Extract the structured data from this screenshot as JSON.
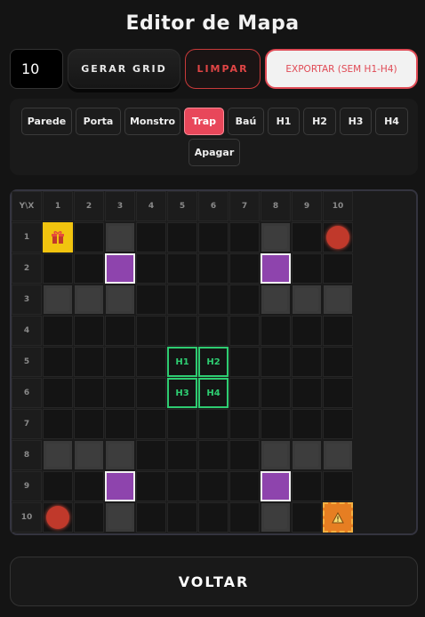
{
  "title": "Editor de Mapa",
  "grid_size_value": "10",
  "buttons": {
    "generate": "GERAR GRID",
    "clear": "LIMPAR",
    "export": "EXPORTAR (SEM H1-H4)",
    "back": "VOLTAR"
  },
  "tools": [
    "Parede",
    "Porta",
    "Monstro",
    "Trap",
    "Baú",
    "H1",
    "H2",
    "H3",
    "H4",
    "Apagar"
  ],
  "active_tool": "Trap",
  "grid": {
    "corner": "Y\\X",
    "cols": [
      "1",
      "2",
      "3",
      "4",
      "5",
      "6",
      "7",
      "8",
      "9",
      "10"
    ],
    "rows": [
      "1",
      "2",
      "3",
      "4",
      "5",
      "6",
      "7",
      "8",
      "9",
      "10"
    ],
    "cells": [
      {
        "x": 1,
        "y": 1,
        "type": "chest"
      },
      {
        "x": 3,
        "y": 1,
        "type": "wall"
      },
      {
        "x": 8,
        "y": 1,
        "type": "wall"
      },
      {
        "x": 10,
        "y": 1,
        "type": "monster"
      },
      {
        "x": 3,
        "y": 2,
        "type": "door"
      },
      {
        "x": 8,
        "y": 2,
        "type": "door"
      },
      {
        "x": 1,
        "y": 3,
        "type": "wall"
      },
      {
        "x": 2,
        "y": 3,
        "type": "wall"
      },
      {
        "x": 3,
        "y": 3,
        "type": "wall"
      },
      {
        "x": 8,
        "y": 3,
        "type": "wall"
      },
      {
        "x": 9,
        "y": 3,
        "type": "wall"
      },
      {
        "x": 10,
        "y": 3,
        "type": "wall"
      },
      {
        "x": 5,
        "y": 5,
        "type": "hroom",
        "label": "H1"
      },
      {
        "x": 6,
        "y": 5,
        "type": "hroom",
        "label": "H2"
      },
      {
        "x": 5,
        "y": 6,
        "type": "hroom",
        "label": "H3"
      },
      {
        "x": 6,
        "y": 6,
        "type": "hroom",
        "label": "H4"
      },
      {
        "x": 1,
        "y": 8,
        "type": "wall"
      },
      {
        "x": 2,
        "y": 8,
        "type": "wall"
      },
      {
        "x": 3,
        "y": 8,
        "type": "wall"
      },
      {
        "x": 8,
        "y": 8,
        "type": "wall"
      },
      {
        "x": 9,
        "y": 8,
        "type": "wall"
      },
      {
        "x": 10,
        "y": 8,
        "type": "wall"
      },
      {
        "x": 3,
        "y": 9,
        "type": "door"
      },
      {
        "x": 8,
        "y": 9,
        "type": "door"
      },
      {
        "x": 1,
        "y": 10,
        "type": "monster"
      },
      {
        "x": 3,
        "y": 10,
        "type": "wall"
      },
      {
        "x": 8,
        "y": 10,
        "type": "wall"
      },
      {
        "x": 10,
        "y": 10,
        "type": "trap"
      }
    ]
  },
  "icons": {
    "chest": "gift-icon",
    "trap": "warning-icon",
    "monster": "monster-dot"
  },
  "colors": {
    "active_tool": "#e8475a",
    "door": "#8e44ad",
    "hroom": "#2ecc71",
    "chest": "#f1c40f",
    "monster": "#c0392b",
    "trap": "#e67e22"
  }
}
